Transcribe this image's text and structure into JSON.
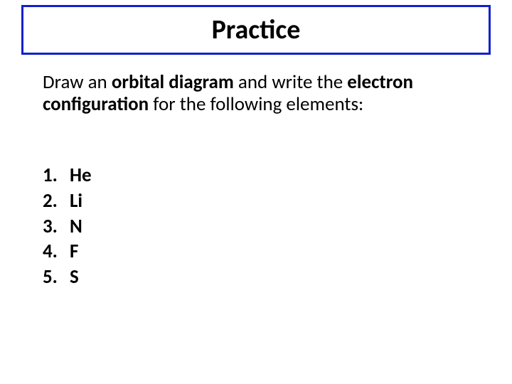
{
  "title": "Practice",
  "instruction": {
    "pre1": "Draw an ",
    "bold1": "orbital diagram",
    "mid": " and write the ",
    "bold2": "electron configuration",
    "post": " for the following elements:"
  },
  "items": [
    {
      "num": "1.",
      "label": "He"
    },
    {
      "num": "2.",
      "label": "Li"
    },
    {
      "num": "3.",
      "label": "N"
    },
    {
      "num": "4.",
      "label": "F"
    },
    {
      "num": "5.",
      "label": "S"
    }
  ]
}
